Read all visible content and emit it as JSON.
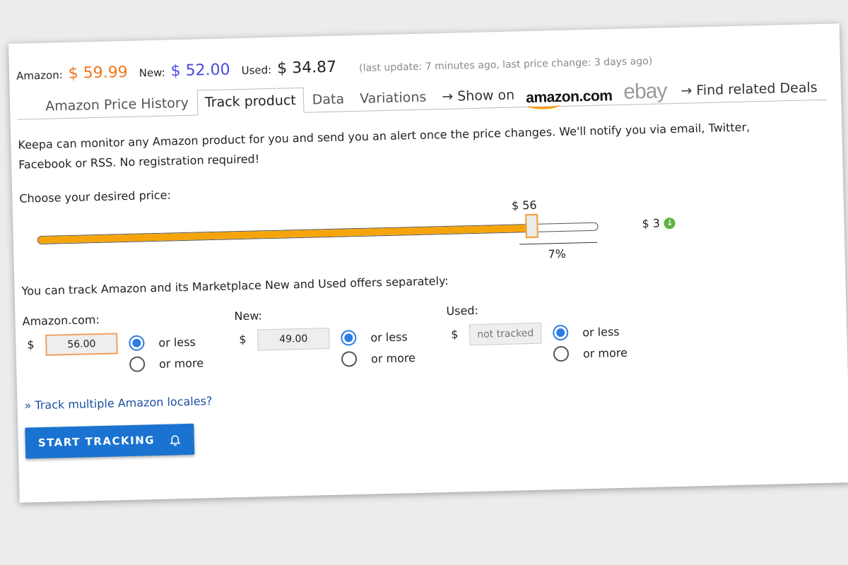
{
  "prices": {
    "amazon_label": "Amazon:",
    "amazon_value": "$ 59.99",
    "new_label": "New:",
    "new_value": "$ 52.00",
    "used_label": "Used:",
    "used_value": "$ 34.87",
    "update_text": "(last update: 7 minutes ago,  last price change: 3 days ago)",
    "colors": {
      "amazon": "#f0761b",
      "new": "#4a4ae0"
    }
  },
  "tabs": [
    {
      "label": "Amazon Price History",
      "active": false
    },
    {
      "label": "Track product",
      "active": true
    },
    {
      "label": "Data",
      "active": false
    },
    {
      "label": "Variations",
      "active": false
    }
  ],
  "links": {
    "show_on": "→  Show on",
    "amazon_logo": "amazon.com",
    "ebay_logo": "ebay",
    "related_deals": "→  Find related Deals"
  },
  "description": "Keepa can monitor any Amazon product for you and send you an alert once the price changes. We'll notify you via email, Twitter, Facebook or RSS. No registration required!",
  "slider": {
    "label": "Choose your desired price:",
    "value_label": "$ 56",
    "value_fraction": 0.884,
    "min_label": "$ 3",
    "percent_label": "7%",
    "fill_color": "#f5a50b",
    "end_icon": "arrow-down-circle-icon"
  },
  "track_text": "You can track Amazon and its Marketplace New and Used offers separately:",
  "markets": [
    {
      "title": "Amazon.com:",
      "currency": "$",
      "value": "56.00",
      "placeholder": "",
      "or_less": "or less",
      "or_more": "or more",
      "selected": "less"
    },
    {
      "title": "New:",
      "currency": "$",
      "value": "49.00",
      "placeholder": "",
      "or_less": "or less",
      "or_more": "or more",
      "selected": "less"
    },
    {
      "title": "Used:",
      "currency": "$",
      "value": "",
      "placeholder": "not tracked",
      "or_less": "or less",
      "or_more": "or more",
      "selected": "less"
    }
  ],
  "multi_locale_link": "» Track multiple Amazon locales?",
  "start_button": {
    "label": "START TRACKING",
    "icon": "bell-icon",
    "color": "#1a73d0"
  }
}
